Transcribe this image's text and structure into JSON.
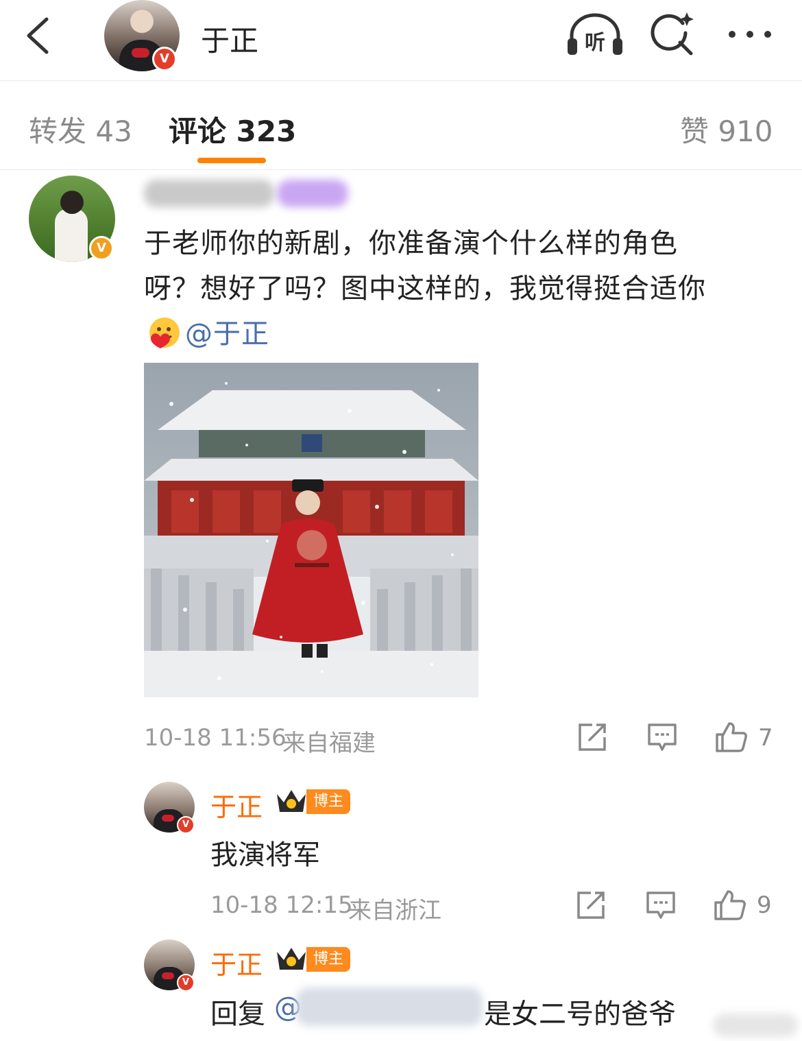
{
  "header": {
    "name": "于正",
    "listen_label": "听",
    "verified": "V"
  },
  "tabs": [
    {
      "label": "转发 43"
    },
    {
      "label": "评论 323"
    },
    {
      "label": "赞 910"
    }
  ],
  "comment": {
    "text_line1": "于老师你的新剧，你准备演个什么样的角色",
    "text_line2": "呀？想好了吗？图中这样的，我觉得挺合适你",
    "mention": "@于正",
    "time": "10-18 11:56",
    "location": "来自福建",
    "likes": "7"
  },
  "replies": [
    {
      "name": "于正",
      "badge": "博主",
      "text": "我演将军",
      "time": "10-18 12:15",
      "location": "来自浙江",
      "likes": "9"
    },
    {
      "name": "于正",
      "badge": "博主",
      "text_prefix": "回复",
      "mention_prefix": "@",
      "text_suffix": "是女二号的爸爷"
    }
  ],
  "colors": {
    "accent": "#ff8200",
    "mention": "#4a6ea9",
    "host_name": "#ff6a00"
  }
}
